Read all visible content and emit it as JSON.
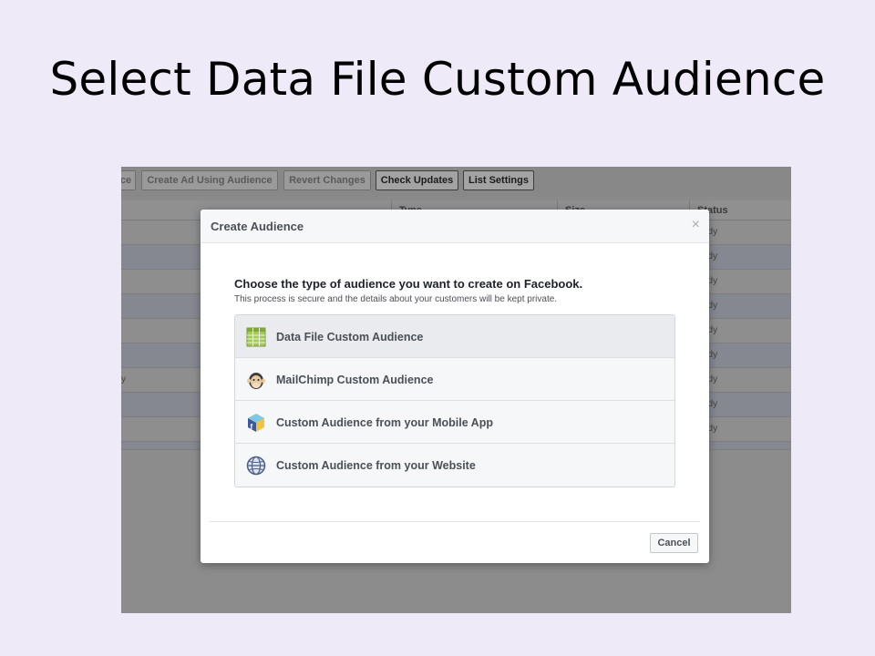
{
  "slide": {
    "title": "Select Data File Custom Audience"
  },
  "toolbar": {
    "buttons": [
      {
        "label": "ce",
        "active": false
      },
      {
        "label": "Create Ad Using Audience",
        "active": false
      },
      {
        "label": "Revert Changes",
        "active": false
      },
      {
        "label": "Check Updates",
        "active": true
      },
      {
        "label": "List Settings",
        "active": true
      }
    ]
  },
  "table": {
    "headers": [
      "Type",
      "Size",
      "Status"
    ],
    "row_status": "ady",
    "side_char": "y"
  },
  "dialog": {
    "title": "Create Audience",
    "close": "×",
    "prompt": "Choose the type of audience you want to create on Facebook.",
    "subprompt": "This process is secure and the details about your customers will be kept private.",
    "options": [
      {
        "label": "Data File Custom Audience",
        "icon": "spreadsheet-icon",
        "selected": true
      },
      {
        "label": "MailChimp Custom Audience",
        "icon": "mailchimp-icon",
        "selected": false
      },
      {
        "label": "Custom Audience from your Mobile App",
        "icon": "mobile-app-icon",
        "selected": false
      },
      {
        "label": "Custom Audience from your Website",
        "icon": "globe-icon",
        "selected": false
      }
    ],
    "cancel_label": "Cancel"
  },
  "colors": {
    "slide_bg": "#eeeaf8",
    "overlay_gray": "#8a8a8a",
    "dialog_header": "#f6f7f9",
    "selected_option": "#e9ebee",
    "text_dark": "#4b4f56"
  }
}
